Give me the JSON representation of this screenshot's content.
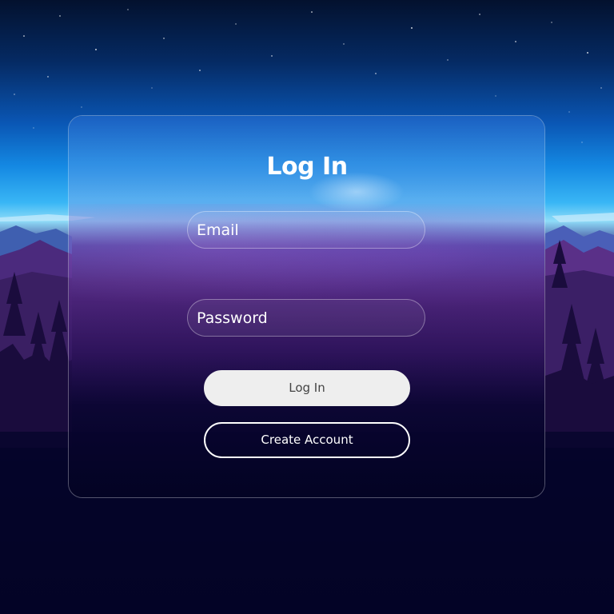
{
  "form": {
    "title": "Log In",
    "email_placeholder": "Email",
    "password_placeholder": "Password",
    "login_label": "Log In",
    "create_account_label": "Create Account"
  },
  "colors": {
    "sky_top": "#03112e",
    "sky_mid": "#1488e2",
    "horizon": "#8fdcf8",
    "forest": "#3b2266",
    "ground": "#03031f",
    "login_button_bg": "#eeeeee",
    "login_button_text": "#444444",
    "text": "#ffffff"
  }
}
